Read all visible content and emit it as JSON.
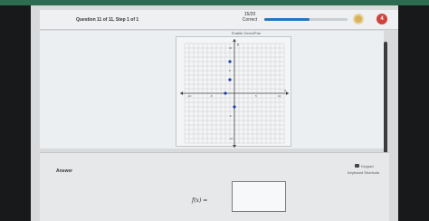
{
  "header": {
    "question": "Question 11 of 11, Step 1 of 1",
    "score": "15/20",
    "score_status": "Correct",
    "progress": 0.54,
    "hearts": "4"
  },
  "graph": {
    "zoom_label": "Enable Zoom/Pan",
    "y_axis": "y",
    "x_axis": "x",
    "x_ticks": [
      "-10",
      "-5",
      "5",
      "10"
    ],
    "y_ticks": [
      "10",
      "5",
      "-5",
      "-10"
    ],
    "points": [
      {
        "x": -1,
        "y": 7
      },
      {
        "x": -1,
        "y": 3
      },
      {
        "x": -2,
        "y": 0
      },
      {
        "x": 0,
        "y": -3
      }
    ]
  },
  "answer": {
    "label": "Answer",
    "keypad": "Keypad",
    "keyboard_shortcuts": "Keyboard Shortcuts",
    "function_label": "f(x) =",
    "input_value": ""
  }
}
